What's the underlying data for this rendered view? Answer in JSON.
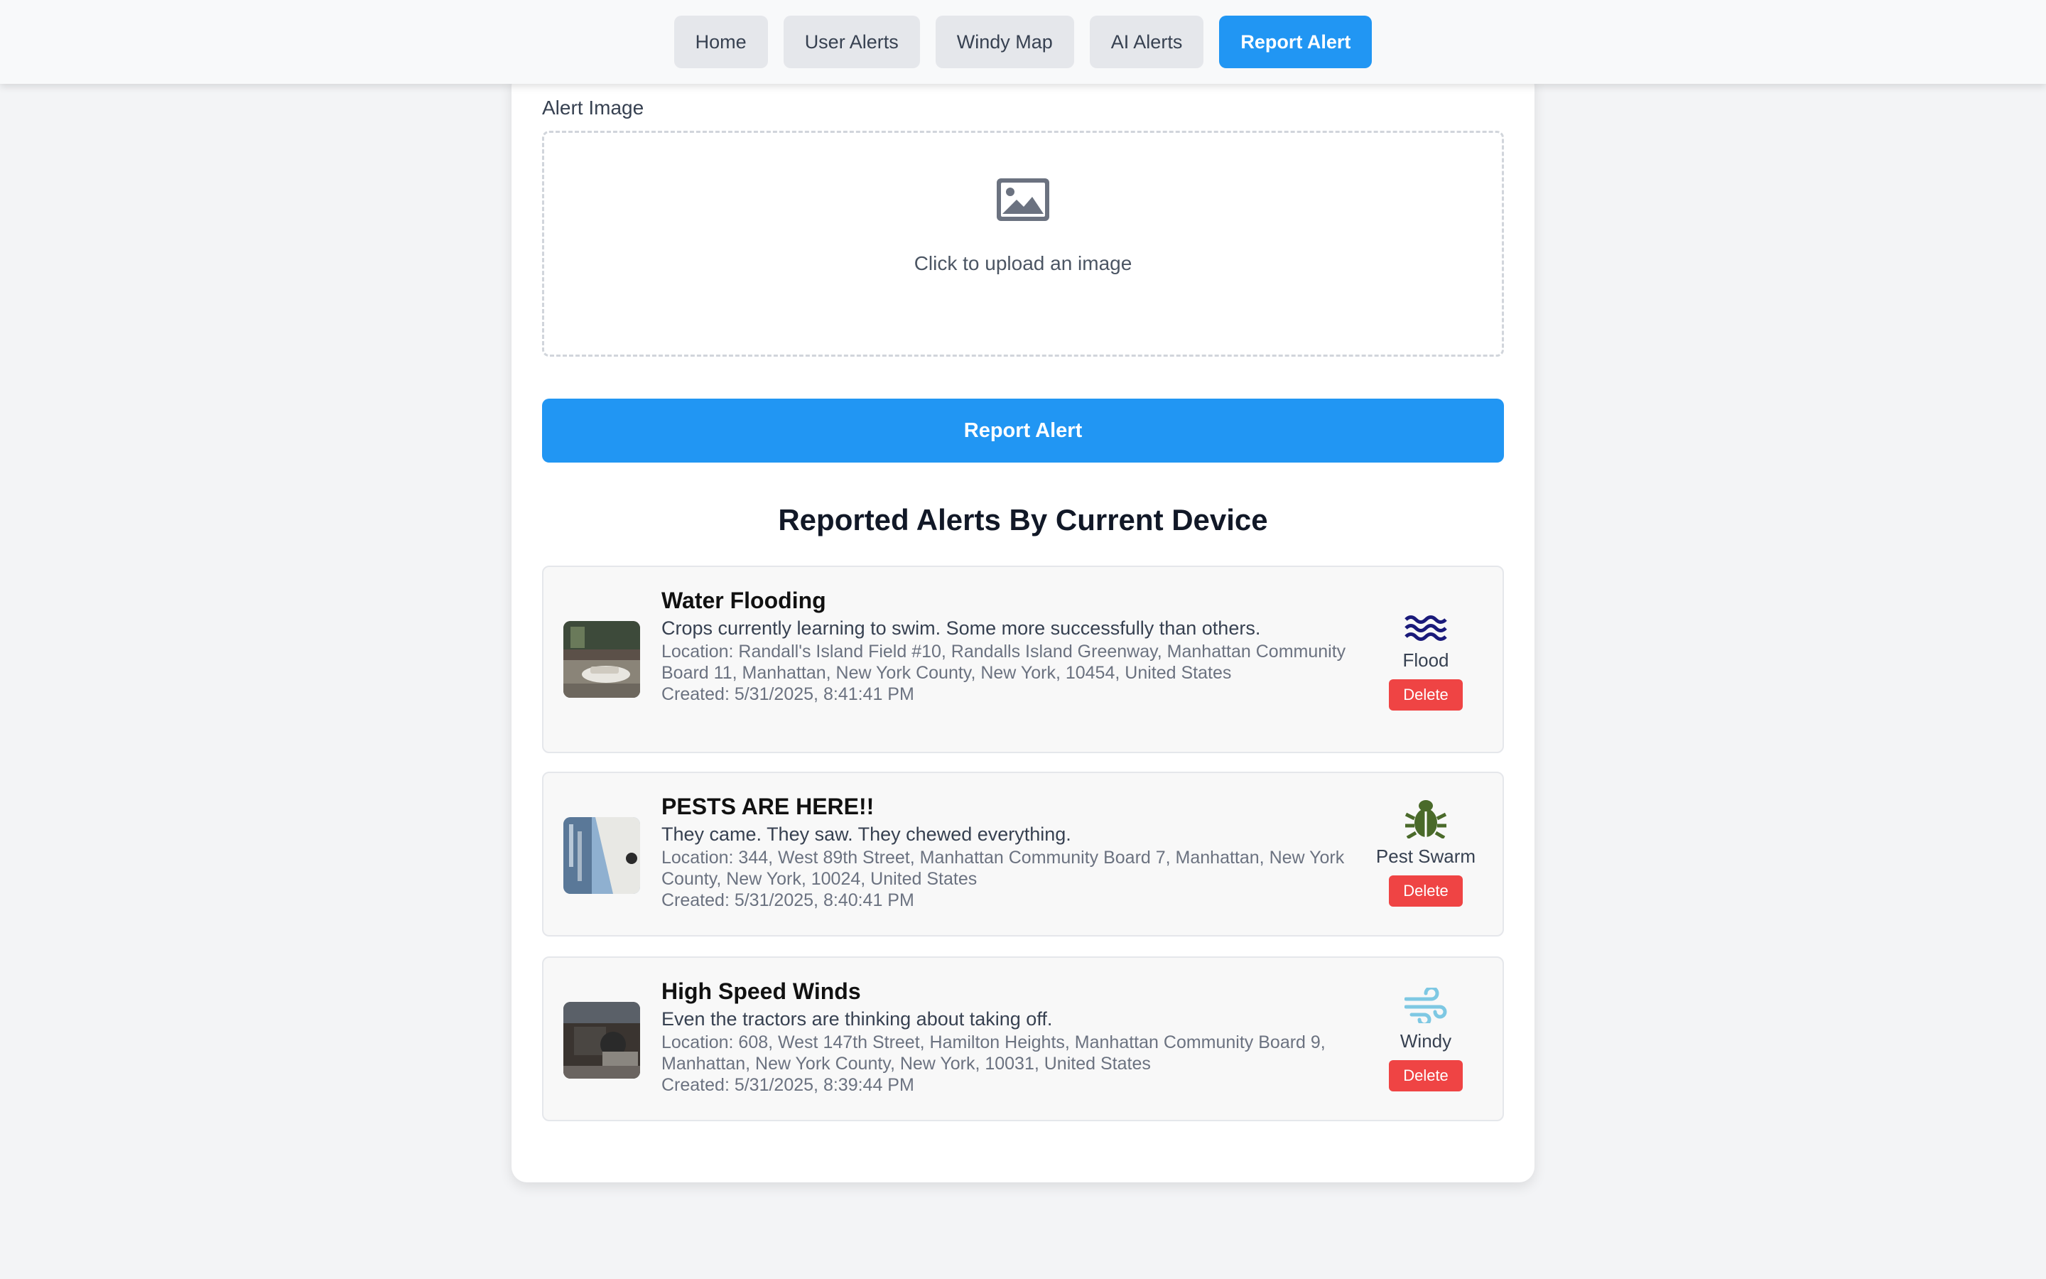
{
  "nav": {
    "items": [
      {
        "label": "Home"
      },
      {
        "label": "User Alerts"
      },
      {
        "label": "Windy Map"
      },
      {
        "label": "AI Alerts"
      },
      {
        "label": "Report Alert"
      }
    ],
    "active": "Report Alert"
  },
  "form": {
    "image_label": "Alert Image",
    "upload_text": "Click to upload an image",
    "upload_icon": "image-icon",
    "submit_label": "Report Alert"
  },
  "reported": {
    "title": "Reported Alerts By Current Device",
    "alerts": [
      {
        "title": "Water Flooding",
        "description": "Crops currently learning to swim. Some more successfully than others.",
        "location": "Location: Randall's Island Field #10, Randalls Island Greenway, Manhattan Community Board 11, Manhattan, New York County, New York, 10454, United States",
        "created": "Created: 5/31/2025, 8:41:41 PM",
        "type": "Flood",
        "type_icon": "flood-waves-icon",
        "delete_label": "Delete"
      },
      {
        "title": "PESTS ARE HERE!!",
        "description": "They came. They saw. They chewed everything.",
        "location": "Location: 344, West 89th Street, Manhattan Community Board 7, Manhattan, New York County, New York, 10024, United States",
        "created": "Created: 5/31/2025, 8:40:41 PM",
        "type": "Pest Swarm",
        "type_icon": "bug-icon",
        "delete_label": "Delete"
      },
      {
        "title": "High Speed Winds",
        "description": "Even the tractors are thinking about taking off.",
        "location": "Location: 608, West 147th Street, Hamilton Heights, Manhattan Community Board 9, Manhattan, New York County, New York, 10031, United States",
        "created": "Created: 5/31/2025, 8:39:44 PM",
        "type": "Windy",
        "type_icon": "wind-icon",
        "delete_label": "Delete"
      }
    ]
  },
  "colors": {
    "primary": "#2196f3",
    "danger": "#ef4444",
    "flood": "#1a1a7a",
    "pest": "#4a6a2a",
    "wind": "#7ec8e3"
  }
}
